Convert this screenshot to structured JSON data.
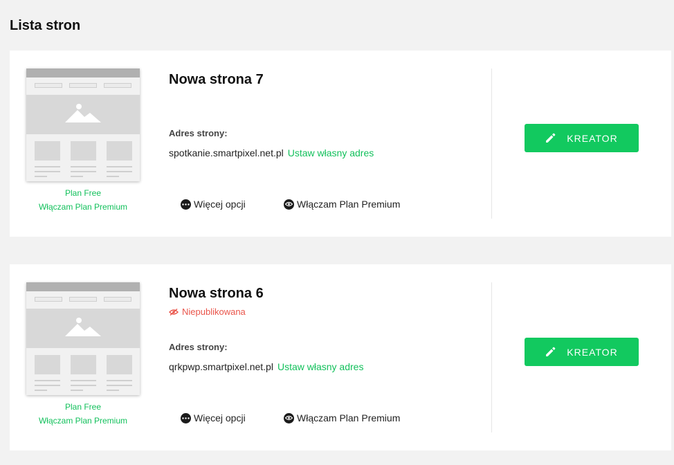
{
  "page": {
    "title": "Lista stron"
  },
  "sites": [
    {
      "name": "Nowa strona 7",
      "status": "",
      "address_label": "Adres strony:",
      "address": "spotkanie.smartpixel.net.pl",
      "custom_address_link": "Ustaw własny adres",
      "plan": "Plan Free",
      "upgrade_link": "Włączam Plan Premium",
      "more_options": "Więcej opcji",
      "premium_option": "Włączam Plan Premium",
      "editor_button": "KREATOR"
    },
    {
      "name": "Nowa strona 6",
      "status": "Niepublikowana",
      "address_label": "Adres strony:",
      "address": "qrkpwp.smartpixel.net.pl",
      "custom_address_link": "Ustaw własny adres",
      "plan": "Plan Free",
      "upgrade_link": "Włączam Plan Premium",
      "more_options": "Więcej opcji",
      "premium_option": "Włączam Plan Premium",
      "editor_button": "KREATOR"
    }
  ],
  "colors": {
    "accent": "#12c95f",
    "link": "#12c05b",
    "unpublished": "#e9544a",
    "background": "#f2f2f2"
  },
  "icons": [
    "eye-slash-icon",
    "more-dots-icon",
    "premium-eye-icon",
    "pencil-icon",
    "image-placeholder-icon"
  ]
}
